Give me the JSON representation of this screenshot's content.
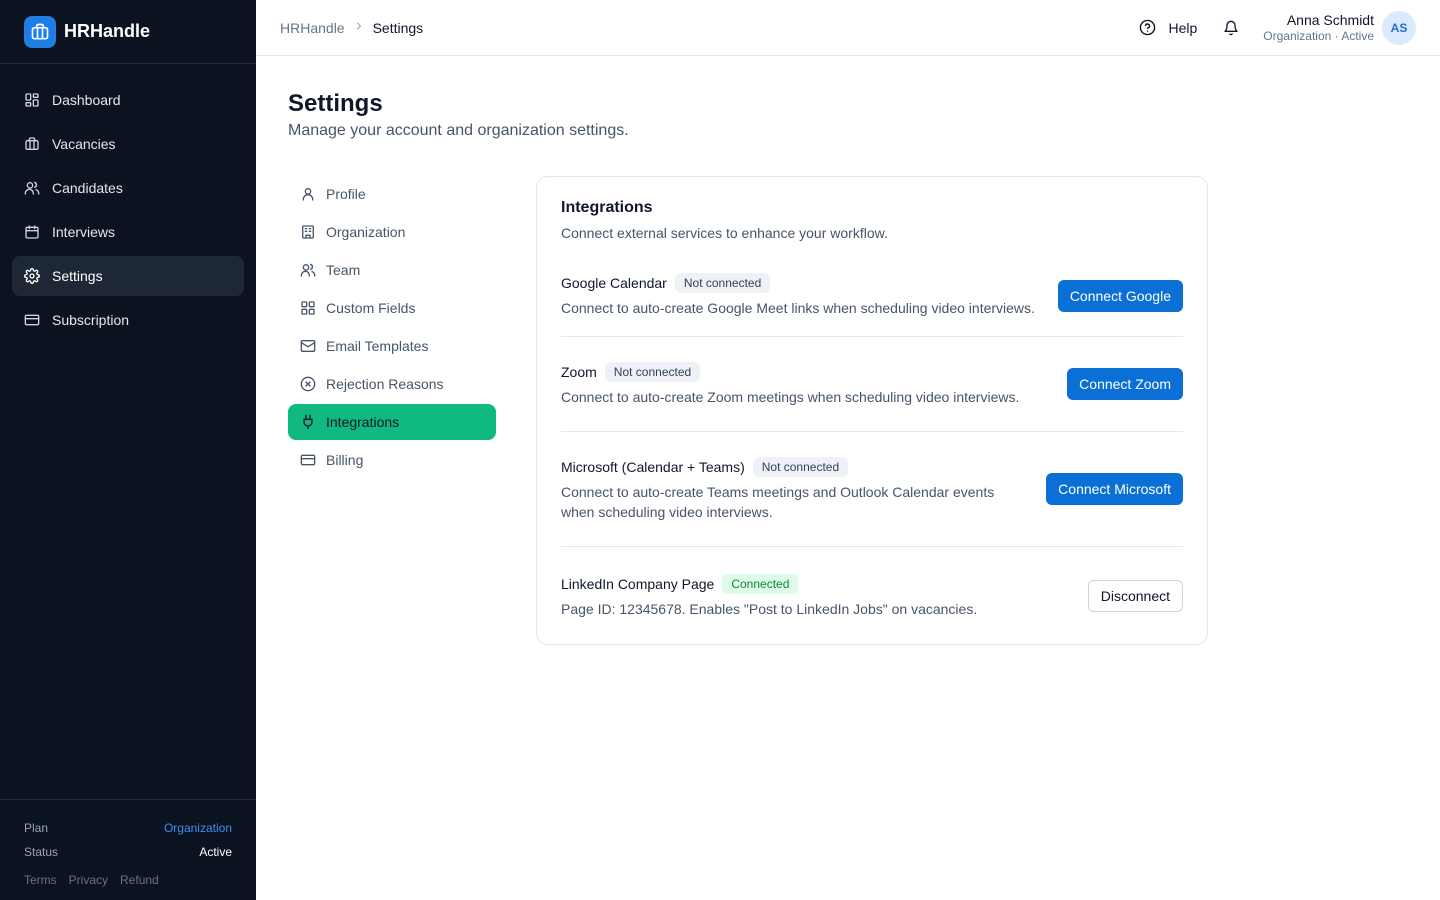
{
  "brand": {
    "name": "HRHandle",
    "accent": "#1d7fe6"
  },
  "sidebar": {
    "items": [
      {
        "label": "Dashboard",
        "icon": "dashboard-icon"
      },
      {
        "label": "Vacancies",
        "icon": "briefcase-icon"
      },
      {
        "label": "Candidates",
        "icon": "users-icon"
      },
      {
        "label": "Interviews",
        "icon": "calendar-icon"
      },
      {
        "label": "Settings",
        "icon": "gear-icon",
        "active": true
      },
      {
        "label": "Subscription",
        "icon": "credit-card-icon"
      }
    ],
    "footer": {
      "plan_label": "Plan",
      "plan_value": "Organization",
      "status_label": "Status",
      "status_value": "Active",
      "links": [
        "Terms",
        "Privacy",
        "Refund"
      ]
    }
  },
  "header": {
    "breadcrumb": [
      "HRHandle",
      "Settings"
    ],
    "help_label": "Help",
    "user": {
      "name": "Anna Schmidt",
      "subtitle": "Organization · Active",
      "initials": "AS"
    }
  },
  "page": {
    "title": "Settings",
    "subtitle": "Manage your account and organization settings."
  },
  "settings_nav": [
    {
      "label": "Profile",
      "icon": "user-icon"
    },
    {
      "label": "Organization",
      "icon": "building-icon"
    },
    {
      "label": "Team",
      "icon": "users-icon"
    },
    {
      "label": "Custom Fields",
      "icon": "grid-icon"
    },
    {
      "label": "Email Templates",
      "icon": "mail-icon"
    },
    {
      "label": "Rejection Reasons",
      "icon": "x-circle-icon"
    },
    {
      "label": "Integrations",
      "icon": "plug-icon",
      "active": true
    },
    {
      "label": "Billing",
      "icon": "credit-card-icon"
    }
  ],
  "integrations": {
    "title": "Integrations",
    "subtitle": "Connect external services to enhance your workflow.",
    "items": [
      {
        "name": "Google Calendar",
        "status": "Not connected",
        "description": "Connect to auto-create Google Meet links when scheduling video interviews.",
        "button": "Connect Google"
      },
      {
        "name": "Zoom",
        "status": "Not connected",
        "description": "Connect to auto-create Zoom meetings when scheduling video interviews.",
        "button": "Connect Zoom"
      },
      {
        "name": "Microsoft (Calendar + Teams)",
        "status": "Not connected",
        "description": "Connect to auto-create Teams meetings and Outlook Calendar events when scheduling video interviews.",
        "button": "Connect Microsoft"
      },
      {
        "name": "LinkedIn Company Page",
        "status": "Connected",
        "description": "Page ID: 12345678. Enables \"Post to LinkedIn Jobs\" on vacancies.",
        "button": "Disconnect"
      }
    ]
  }
}
